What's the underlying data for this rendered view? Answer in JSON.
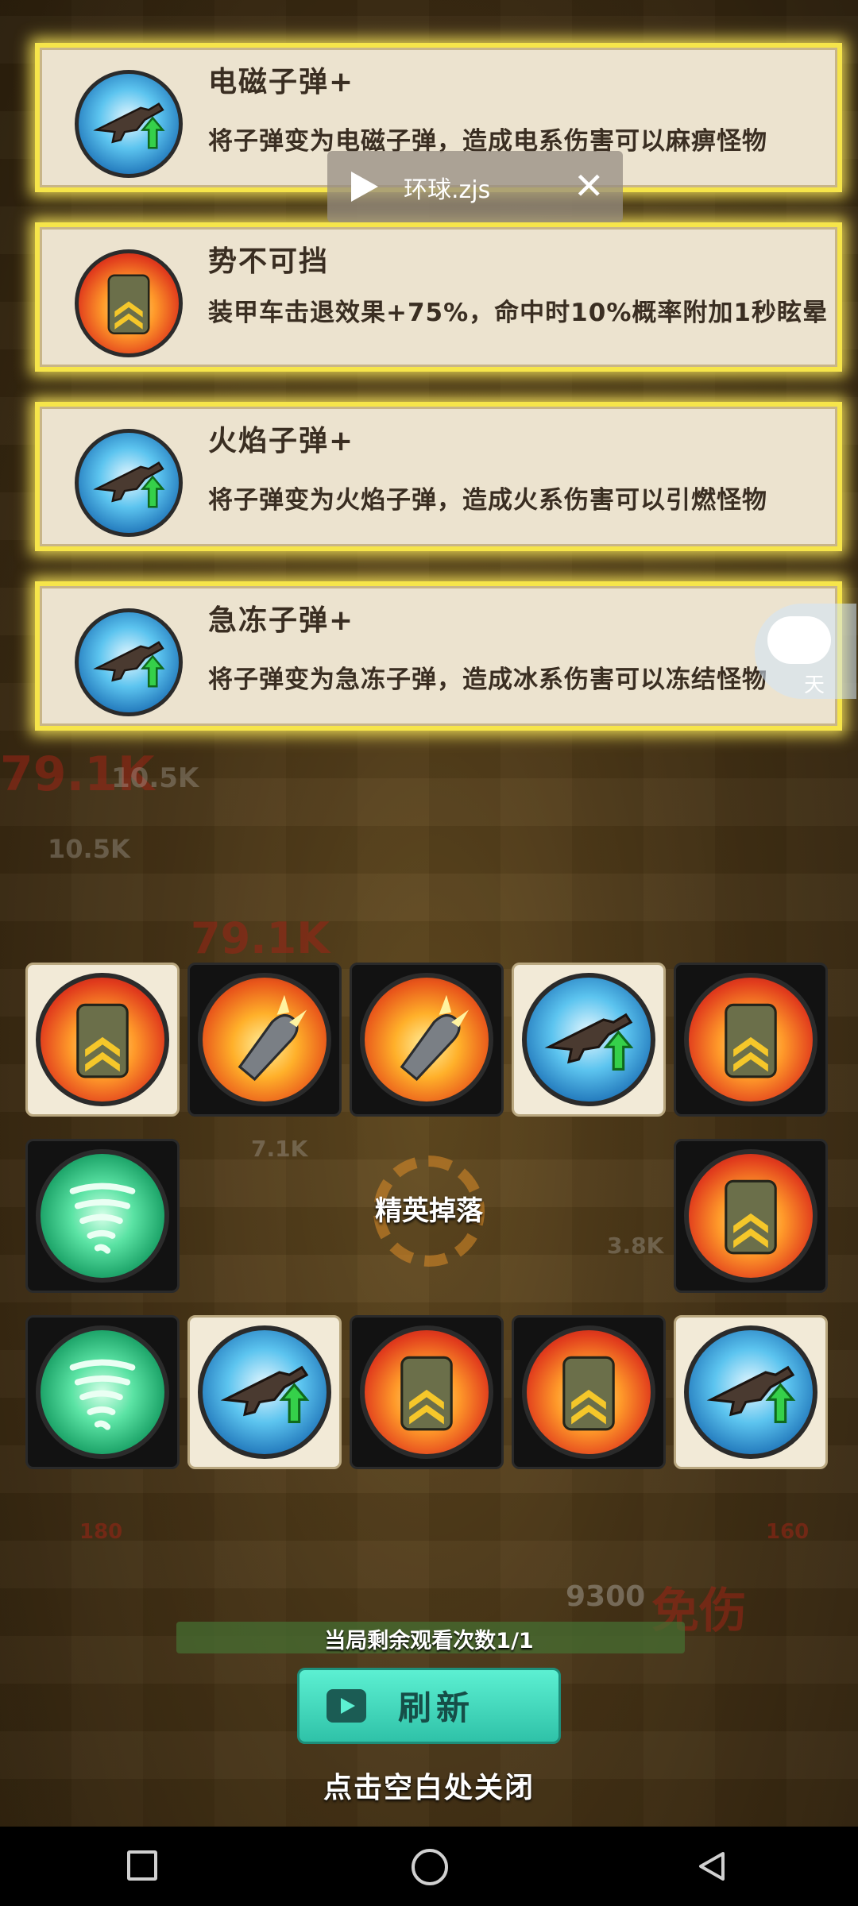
{
  "mini_player": {
    "title": "环球.zjs",
    "close": "✕"
  },
  "assistant": {
    "label": "天"
  },
  "cards": [
    {
      "title": "电磁子弹+",
      "description": "将子弹变为电磁子弹，造成电系伤害可以麻痹怪物",
      "icon": "rifle-upgrade-icon"
    },
    {
      "title": "势不可挡",
      "description": "装甲车击退效果+75%，命中时10%概率附加1秒眩晕",
      "icon": "armor-chevron-icon"
    },
    {
      "title": "火焰子弹+",
      "description": "将子弹变为火焰子弹，造成火系伤害可以引燃怪物",
      "icon": "rifle-upgrade-icon"
    },
    {
      "title": "急冻子弹+",
      "description": "将子弹变为急冻子弹，造成冰系伤害可以冻结怪物",
      "icon": "rifle-upgrade-icon"
    }
  ],
  "grid_title": "精英掉落",
  "grid": [
    {
      "icon": "armor-chevron-icon",
      "style": "light"
    },
    {
      "icon": "fire-bullet-icon",
      "style": "dark"
    },
    {
      "icon": "fire-bullet-icon",
      "style": "dark"
    },
    {
      "icon": "rifle-upgrade-icon",
      "style": "light"
    },
    {
      "icon": "armor-chevron-icon",
      "style": "dark"
    },
    {
      "icon": "tornado-icon",
      "style": "dark"
    },
    {
      "icon": "armor-chevron-icon",
      "style": "dark"
    },
    {
      "icon": "tornado-icon",
      "style": "dark"
    },
    {
      "icon": "rifle-upgrade-icon",
      "style": "light"
    },
    {
      "icon": "armor-chevron-icon",
      "style": "dark"
    },
    {
      "icon": "armor-chevron-icon",
      "style": "dark"
    },
    {
      "icon": "rifle-upgrade-icon",
      "style": "light"
    }
  ],
  "background_text": {
    "dmg_a": "79.1K",
    "dmg_b": "10.5K",
    "dmg_c": "10.5K",
    "dmg_d": "79.1K",
    "dmg_e": "7.1K",
    "dmg_f": "3.8K",
    "energy_left": "180",
    "energy_right": "160",
    "hp": "9300",
    "immune": "免伤"
  },
  "views_left": "当局剩余观看次数1/1",
  "refresh_label": "刷新",
  "close_hint": "点击空白处关闭",
  "colors": {
    "card_border": "#f6e54a",
    "card_bg": "#ece3cf",
    "refresh_btn": "#3fd9bd"
  }
}
